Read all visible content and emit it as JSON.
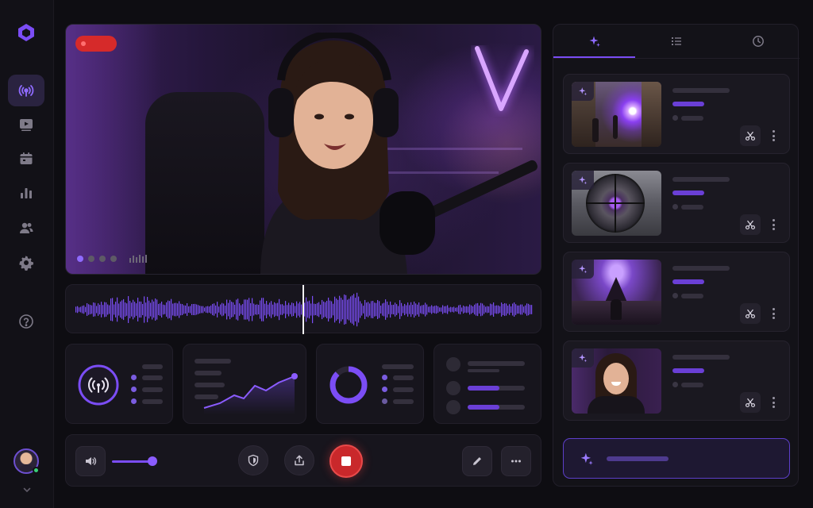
{
  "sidebar": {
    "items": [
      {
        "name": "broadcast-icon",
        "active": true
      },
      {
        "name": "video-library-icon",
        "active": false
      },
      {
        "name": "calendar-icon",
        "active": false
      },
      {
        "name": "analytics-icon",
        "active": false
      },
      {
        "name": "audience-icon",
        "active": false
      },
      {
        "name": "settings-icon",
        "active": false
      },
      {
        "name": "help-icon",
        "active": false
      }
    ]
  },
  "stream": {
    "live_indicator_color": "#d62a2a",
    "scene_dots": 4,
    "active_scene": 1
  },
  "controls": {
    "volume_level": 0.8
  },
  "colors": {
    "accent": "#7b4df5",
    "record_red": "#c9282b",
    "background": "#0e0d12",
    "card": "#17151d"
  },
  "right_panel": {
    "tabs": [
      {
        "name": "ai-highlights-tab",
        "icon": "sparkle-icon",
        "active": true
      },
      {
        "name": "list-tab",
        "icon": "list-icon",
        "active": false
      },
      {
        "name": "history-tab",
        "icon": "clock-icon",
        "active": false
      }
    ],
    "clips": [
      {
        "scene": "magic-blast"
      },
      {
        "scene": "sniper-scope"
      },
      {
        "scene": "dark-castle"
      },
      {
        "scene": "streamer-reaction"
      }
    ]
  }
}
